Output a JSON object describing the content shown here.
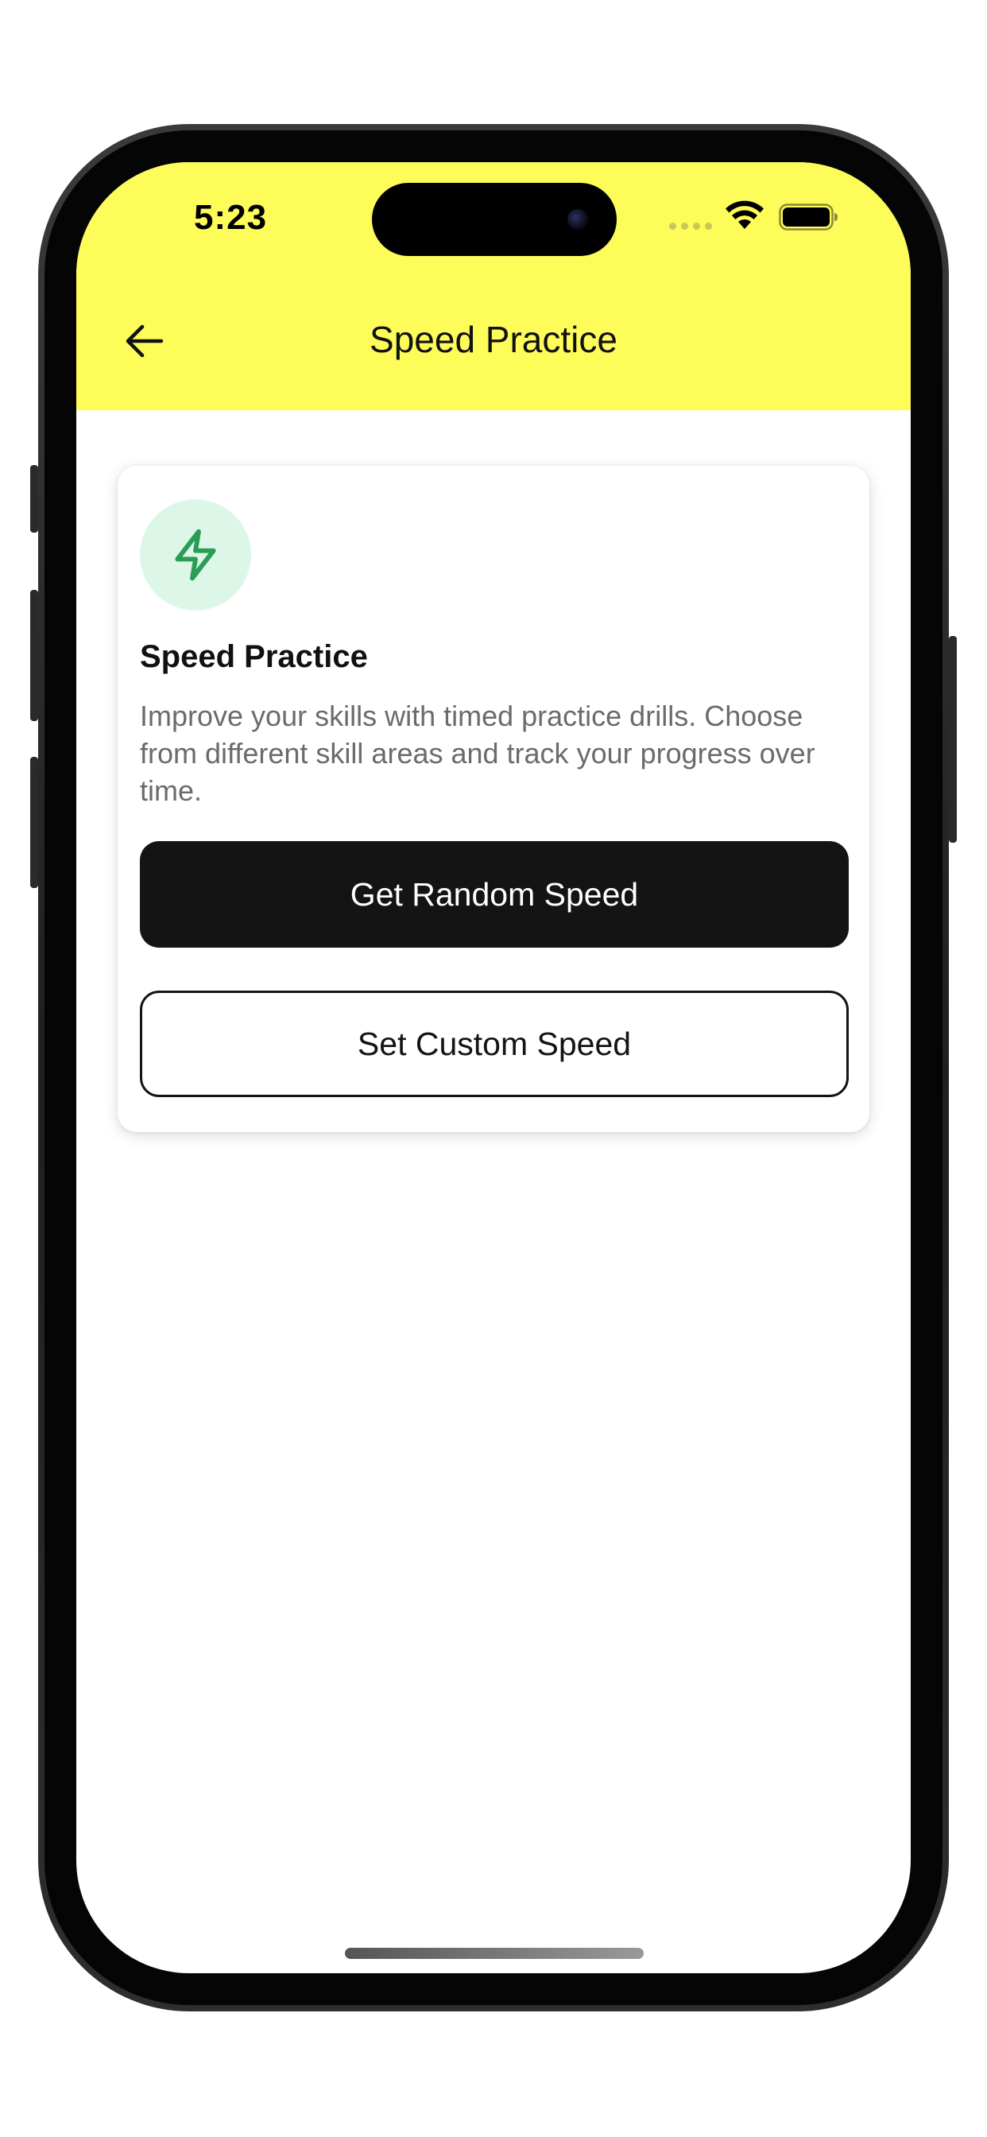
{
  "status_bar": {
    "time": "5:23",
    "icons": [
      "signal-dots-icon",
      "wifi-icon",
      "battery-icon"
    ]
  },
  "header": {
    "title": "Speed Practice",
    "back_icon": "arrow-left-icon",
    "background_color": "#fefc58"
  },
  "card": {
    "icon": "lightning-bolt-icon",
    "icon_color": "#2a9d55",
    "icon_bg_color": "#dcf7e8",
    "title": "Speed Practice",
    "description": "Improve your skills with timed practice drills. Choose from different skill areas and track your progress over time.",
    "primary_button_label": "Get Random Speed",
    "secondary_button_label": "Set Custom Speed"
  }
}
